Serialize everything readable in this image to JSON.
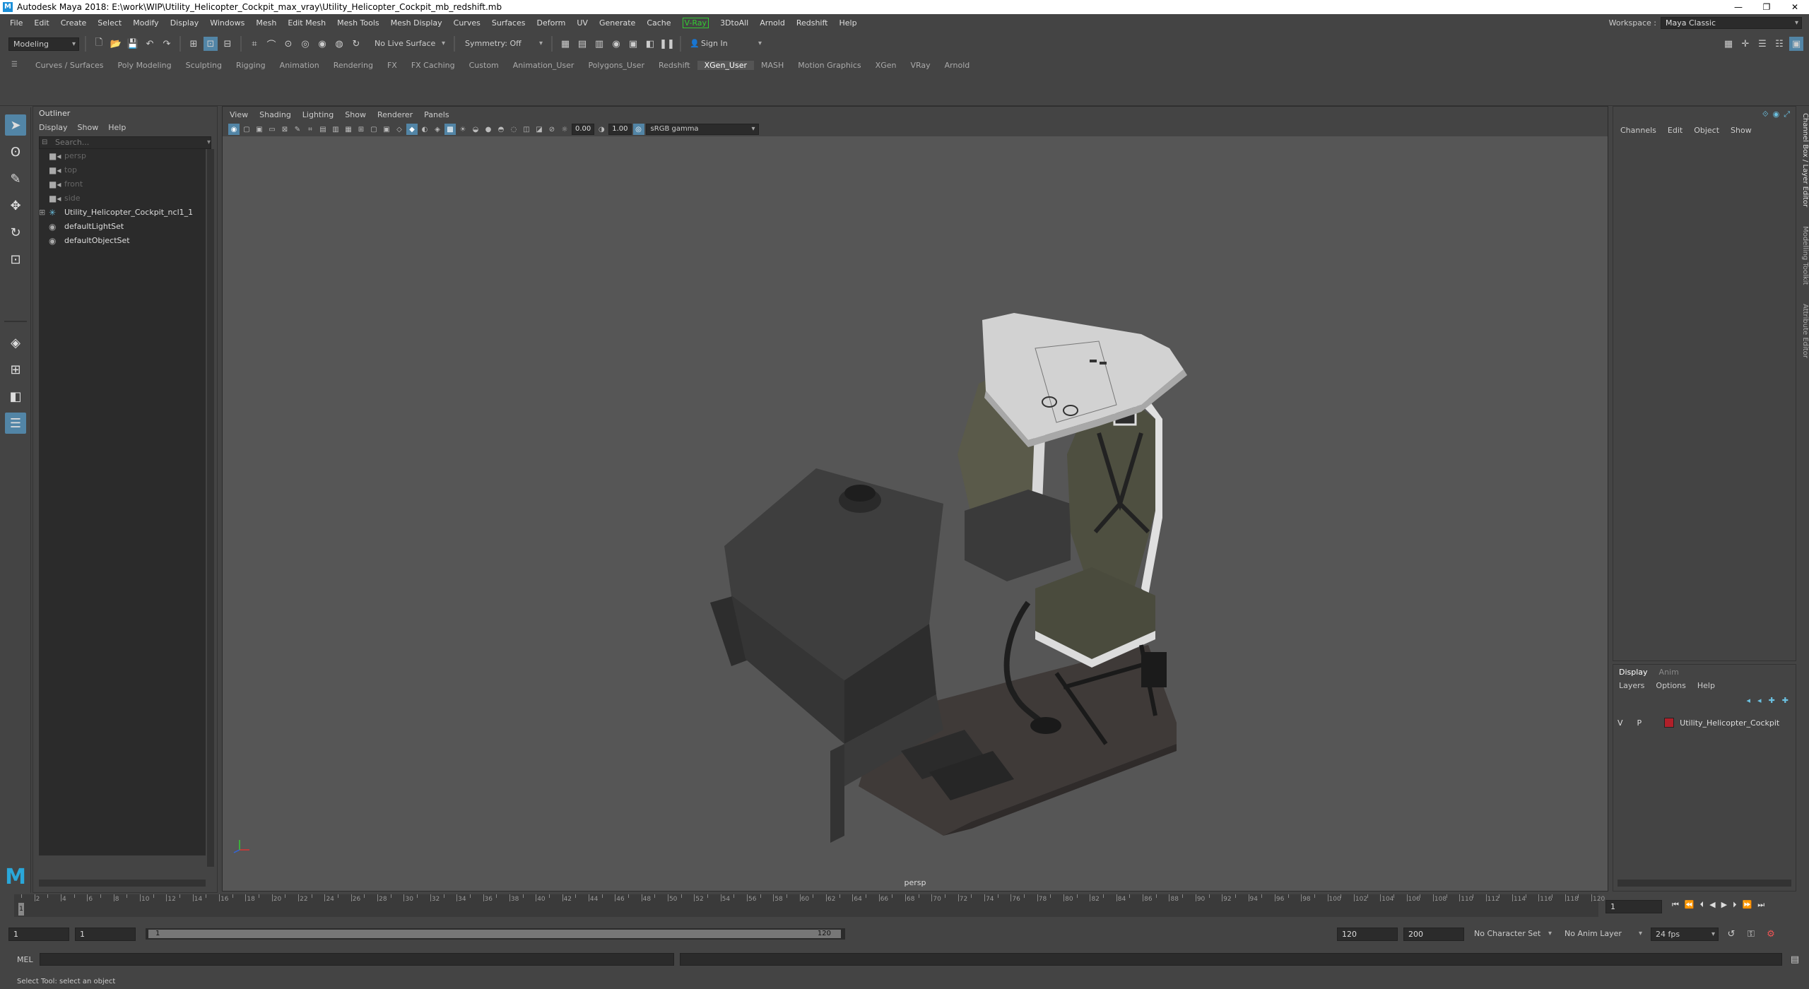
{
  "window": {
    "title": "Autodesk Maya 2018: E:\\work\\WIP\\Utility_Helicopter_Cockpit_max_vray\\Utility_Helicopter_Cockpit_mb_redshift.mb",
    "minimize": "—",
    "restore": "❐",
    "close": "✕"
  },
  "menubar": [
    "File",
    "Edit",
    "Create",
    "Select",
    "Modify",
    "Display",
    "Windows",
    "Mesh",
    "Edit Mesh",
    "Mesh Tools",
    "Mesh Display",
    "Curves",
    "Surfaces",
    "Deform",
    "UV",
    "Generate",
    "Cache"
  ],
  "menubar_vray": "V-Ray",
  "menubar_extra": [
    "3DtoAll",
    "Arnold",
    "Redshift",
    "Help"
  ],
  "workspace": {
    "label": "Workspace :",
    "value": "Maya Classic"
  },
  "statusline": {
    "mode": "Modeling",
    "live_surface": "No Live Surface",
    "symmetry": "Symmetry: Off",
    "sign_in": "Sign In"
  },
  "shelf_tabs": [
    "Curves / Surfaces",
    "Poly Modeling",
    "Sculpting",
    "Rigging",
    "Animation",
    "Rendering",
    "FX",
    "FX Caching",
    "Custom",
    "Animation_User",
    "Polygons_User",
    "Redshift",
    "XGen_User",
    "MASH",
    "Motion Graphics",
    "XGen",
    "VRay",
    "Arnold"
  ],
  "shelf_active": "XGen_User",
  "outliner": {
    "title": "Outliner",
    "menu": [
      "Display",
      "Show",
      "Help"
    ],
    "search_placeholder": "Search...",
    "items": [
      {
        "label": "persp",
        "dim": true,
        "icon": "camera"
      },
      {
        "label": "top",
        "dim": true,
        "icon": "camera"
      },
      {
        "label": "front",
        "dim": true,
        "icon": "camera"
      },
      {
        "label": "side",
        "dim": true,
        "icon": "camera"
      },
      {
        "label": "Utility_Helicopter_Cockpit_ncl1_1",
        "dim": false,
        "icon": "group",
        "expandable": true
      },
      {
        "label": "defaultLightSet",
        "dim": false,
        "icon": "set"
      },
      {
        "label": "defaultObjectSet",
        "dim": false,
        "icon": "set"
      }
    ]
  },
  "viewport": {
    "menu": [
      "View",
      "Shading",
      "Lighting",
      "Show",
      "Renderer",
      "Panels"
    ],
    "exposure": "0.00",
    "gamma": "1.00",
    "colorspace": "sRGB gamma",
    "camera_label": "persp"
  },
  "channelbox": {
    "menu": [
      "Channels",
      "Edit",
      "Object",
      "Show"
    ]
  },
  "side_tabs": [
    "Channel Box / Layer Editor",
    "Modelling Toolkit",
    "Attribute Editor"
  ],
  "layer_editor": {
    "tabs": [
      "Display",
      "Anim"
    ],
    "menu": [
      "Layers",
      "Options",
      "Help"
    ],
    "layer": {
      "v": "V",
      "p": "P",
      "name": "Utility_Helicopter_Cockpit",
      "color": "#b0202a"
    }
  },
  "timeslider": {
    "ticks": [
      2,
      4,
      6,
      8,
      10,
      12,
      14,
      16,
      18,
      20,
      22,
      24,
      26,
      28,
      30,
      32,
      34,
      36,
      38,
      40,
      42,
      44,
      46,
      48,
      50,
      52,
      54,
      56,
      58,
      60,
      62,
      64,
      66,
      68,
      70,
      72,
      74,
      76,
      78,
      80,
      82,
      84,
      86,
      88,
      90,
      92,
      94,
      96,
      98,
      100,
      102,
      104,
      106,
      108,
      110,
      112,
      114,
      116,
      118,
      120
    ],
    "min": 1,
    "max": 120,
    "current": 1,
    "current_field": "1"
  },
  "rangeslider": {
    "start": "1",
    "start2": "1",
    "range_label_start": "1",
    "range_label_end": "120",
    "end": "120",
    "end2": "200",
    "char_set": "No Character Set",
    "anim_layer": "No Anim Layer",
    "fps": "24 fps"
  },
  "cmdline": {
    "label": "MEL"
  },
  "helpline": "Select Tool: select an object"
}
